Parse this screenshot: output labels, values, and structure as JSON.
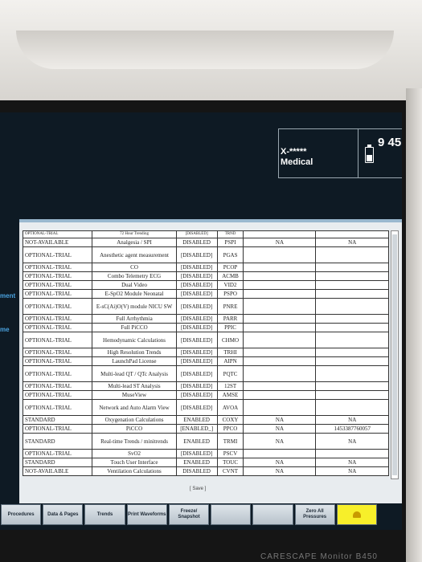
{
  "status": {
    "patient_id": "X-*****",
    "department": "Medical",
    "time": "9 45",
    "battery_level": 0.5
  },
  "side_labels": [
    "ment",
    "me"
  ],
  "table": {
    "rows": [
      [
        "OPTIONAL-TRIAL",
        "72 Hour Trending",
        "[DISABLED]",
        "TRND",
        "",
        ""
      ],
      [
        "NOT-AVAILABLE",
        "Analgesia / SPI",
        "DISABLED",
        "PSPI",
        "NA",
        "NA"
      ],
      [
        "OPTIONAL-TRIAL",
        "Anesthetic agent measurement",
        "[DISABLED]",
        "PGAS",
        "",
        ""
      ],
      [
        "OPTIONAL-TRIAL",
        "CO",
        "[DISABLED]",
        "PCOP",
        "",
        ""
      ],
      [
        "OPTIONAL-TRIAL",
        "Combo Telemetry ECG",
        "[DISABLED]",
        "ACMB",
        "",
        ""
      ],
      [
        "OPTIONAL-TRIAL",
        "Dual Video",
        "[DISABLED]",
        "VID2",
        "",
        ""
      ],
      [
        "OPTIONAL-TRIAL",
        "E-SpO2 Module Neonatal",
        "[DISABLED]",
        "PSPO",
        "",
        ""
      ],
      [
        "OPTIONAL-TRIAL",
        "E-sC(Ai)O(V) module NICU SW",
        "[DISABLED]",
        "PNRE",
        "",
        ""
      ],
      [
        "OPTIONAL-TRIAL",
        "Full Arrhythmia",
        "[DISABLED]",
        "PARR",
        "",
        ""
      ],
      [
        "OPTIONAL-TRIAL",
        "Full PiCCO",
        "[DISABLED]",
        "PPIC",
        "",
        ""
      ],
      [
        "OPTIONAL-TRIAL",
        "Hemodynamic Calculations",
        "[DISABLED]",
        "CHMO",
        "",
        ""
      ],
      [
        "OPTIONAL-TRIAL",
        "High Resolution Trends",
        "[DISABLED]",
        "TRHI",
        "",
        ""
      ],
      [
        "OPTIONAL-TRIAL",
        "LaunchPad License",
        "[DISABLED]",
        "AIPN",
        "",
        ""
      ],
      [
        "OPTIONAL-TRIAL",
        "Multi-lead QT / QTc Analysis",
        "[DISABLED]",
        "PQTC",
        "",
        ""
      ],
      [
        "OPTIONAL-TRIAL",
        "Multi-lead ST Analysis",
        "[DISABLED]",
        "12ST",
        "",
        ""
      ],
      [
        "OPTIONAL-TRIAL",
        "MuseView",
        "[DISABLED]",
        "AMSE",
        "",
        ""
      ],
      [
        "OPTIONAL-TRIAL",
        "Network and Auto Alarm View",
        "[DISABLED]",
        "AVOA",
        "",
        ""
      ],
      [
        "STANDARD",
        "Oxygenation Calculations",
        "ENABLED",
        "COXY",
        "NA",
        "NA"
      ],
      [
        "OPTIONAL-TRIAL",
        "PiCCO",
        "[ENABLED_]",
        "PPCO",
        "NA",
        "1453387760057"
      ],
      [
        "STANDARD",
        "Real-time Trends / minitrends",
        "ENABLED",
        "TRMI",
        "NA",
        "NA"
      ],
      [
        "OPTIONAL-TRIAL",
        "SvO2",
        "[DISABLED]",
        "PSCV",
        "",
        ""
      ],
      [
        "STANDARD",
        "Touch User Interface",
        "ENABLED",
        "TOUC",
        "NA",
        "NA"
      ],
      [
        "NOT-AVAILABLE",
        "Ventilation Calculations",
        "DISABLED",
        "CVNT",
        "NA",
        "NA"
      ]
    ]
  },
  "dialog": {
    "save_label": "[ Save ]"
  },
  "toolbar": {
    "buttons": [
      "Procedures",
      "Data & Pages",
      "Trends",
      "Print Waveforms",
      "Freeze/ Snapshot",
      "",
      "",
      "Zero All Pressures"
    ],
    "alarm_icon": "bell-icon",
    "alarm_color": "#f7ef2a"
  },
  "device": {
    "brand": "CARESCAPE Monitor B450"
  }
}
